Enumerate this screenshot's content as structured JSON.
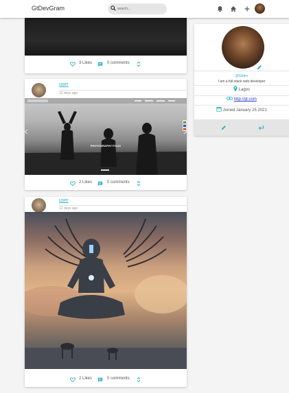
{
  "app": {
    "brand": "GtDevGram"
  },
  "search": {
    "placeholder": "search..."
  },
  "topbar_icons": [
    "bell-icon",
    "home-icon",
    "plus-icon"
  ],
  "colors": {
    "accent": "#2ab0c8",
    "link": "#2a3cc8"
  },
  "posts": [
    {
      "likes": "3 Likes",
      "comments": "0 comments"
    },
    {
      "user": "user",
      "time": "12 days ago",
      "likes": "2 Likes",
      "comments": "0 comments",
      "image_header": "PHOTOGRAPHY FOLIO"
    },
    {
      "user": "user",
      "time": "12 days ago",
      "likes": "2 Likes",
      "comments": "0 comments"
    }
  ],
  "profile": {
    "handle": "@Gtdev",
    "bio": "I am a full-stack web developer",
    "location": "Lagos",
    "website": "http://gt.com",
    "joined": "Joined January 25 2021"
  }
}
